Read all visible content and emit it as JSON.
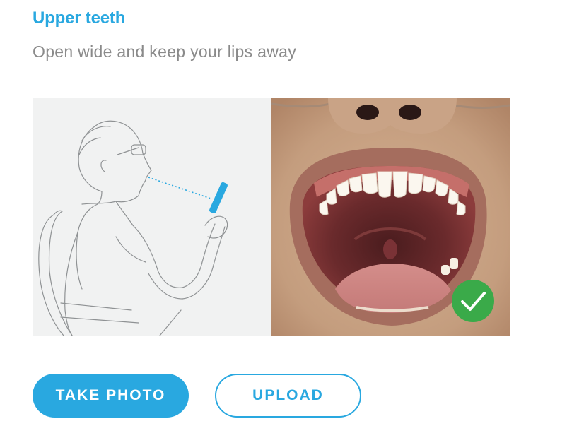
{
  "step": {
    "title": "Upper teeth",
    "instruction": "Open wide and keep your lips away"
  },
  "illustration": {
    "icon": "person-photographing-mouth-illustration"
  },
  "example_photo": {
    "icon": "open-mouth-upper-teeth-photo",
    "status": "approved"
  },
  "actions": {
    "take_photo_label": "TAKE PHOTO",
    "upload_label": "UPLOAD"
  },
  "colors": {
    "accent": "#29a8e0",
    "subtitle": "#8a8a8a",
    "success": "#3aaa49"
  }
}
